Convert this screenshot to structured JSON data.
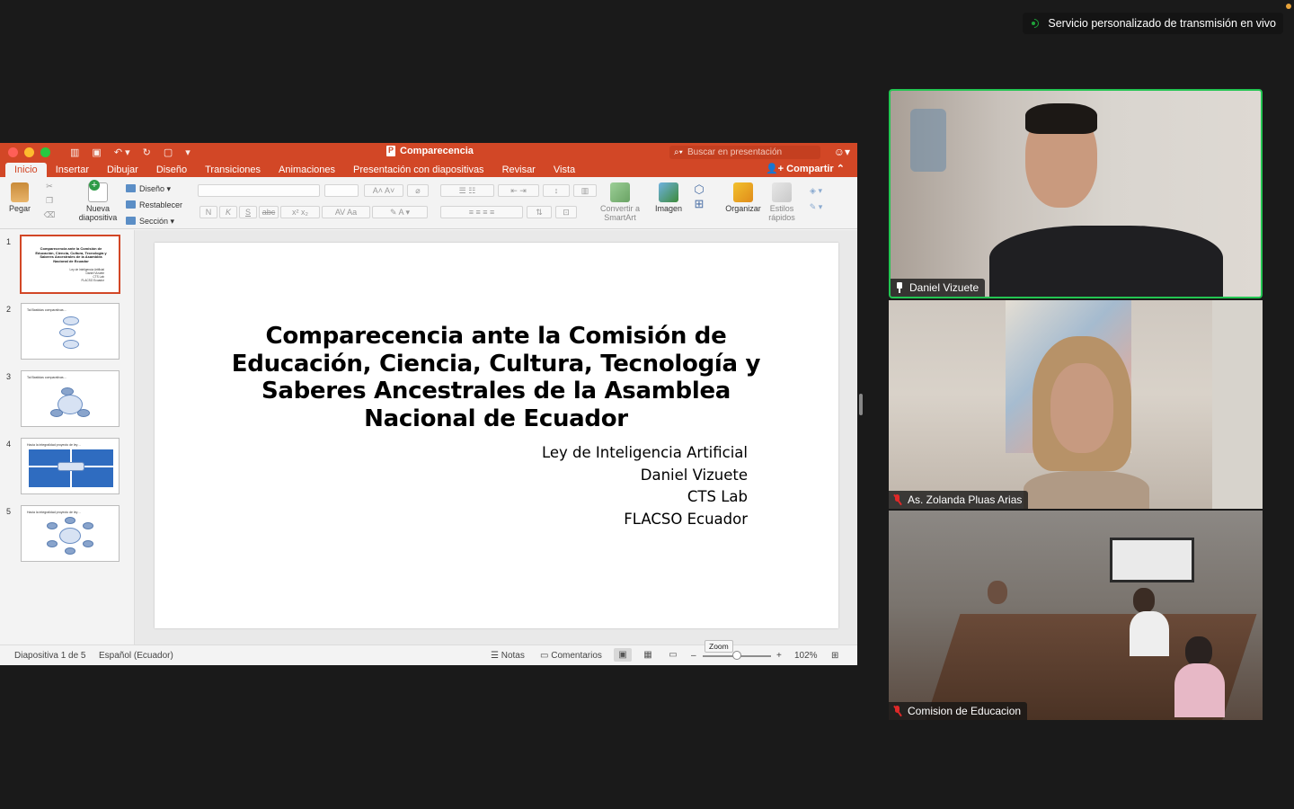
{
  "zoom_banner": {
    "text": "Servicio personalizado de transmisión en vivo"
  },
  "ppt": {
    "document_title": "Comparecencia",
    "search_placeholder": "Buscar en presentación",
    "tabs": [
      "Inicio",
      "Insertar",
      "Dibujar",
      "Diseño",
      "Transiciones",
      "Animaciones",
      "Presentación con diapositivas",
      "Revisar",
      "Vista"
    ],
    "active_tab": "Inicio",
    "share_label": "Compartir",
    "ribbon": {
      "paste": "Pegar",
      "new_slide": "Nueva diapositiva",
      "layout": "Diseño",
      "reset": "Restablecer",
      "section": "Sección",
      "convert_smartart": "Convertir a SmartArt",
      "image": "Imagen",
      "arrange": "Organizar",
      "quick_styles": "Estilos rápidos",
      "bold": "N",
      "italic": "K",
      "underline": "S",
      "strike": "abc"
    },
    "thumbnails": [
      {
        "number": "1",
        "title": "Comparecencia ante la Comisión de Educación, Ciencia, Cultura, Tecnología y Saberes Ancestrales de la Asamblea Nacional de Ecuador",
        "sub": "Ley de Inteligencia Artificial\nDaniel Vizuete\nCTS Lab\nFLACSO Ecuador"
      },
      {
        "number": "2",
        "title": "Tal Bastidas comparativas…"
      },
      {
        "number": "3",
        "title": "Tal Bastidas comparativas…"
      },
      {
        "number": "4",
        "title": "Hacia la integralidad proyecto de ley…"
      },
      {
        "number": "5",
        "title": "Hacia la integralidad proyecto de ley…"
      }
    ],
    "slide": {
      "title": "Comparecencia ante la Comisión de Educación, Ciencia, Cultura, Tecnología y Saberes Ancestrales de la Asamblea Nacional de Ecuador",
      "subtitle_lines": [
        "Ley de Inteligencia Artificial",
        "Daniel Vizuete",
        "CTS Lab",
        "FLACSO Ecuador"
      ]
    },
    "status": {
      "slide_counter": "Diapositiva 1 de 5",
      "language": "Español (Ecuador)",
      "notes": "Notas",
      "comments": "Comentarios",
      "zoom_level": "102%",
      "zoom_tooltip": "Zoom"
    }
  },
  "participants": [
    {
      "name": "Daniel Vizuete",
      "muted": false,
      "active_speaker": true
    },
    {
      "name": "As. Zolanda Pluas Arias",
      "muted": true,
      "active_speaker": false
    },
    {
      "name": "Comision de Educacion",
      "muted": true,
      "active_speaker": false
    }
  ],
  "colors": {
    "ppt_accent": "#d24726",
    "speaker_border": "#23c552",
    "muted_red": "#e02828"
  }
}
